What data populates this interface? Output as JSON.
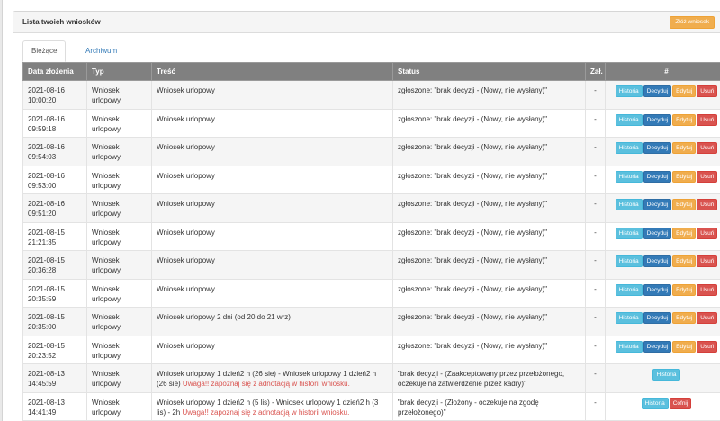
{
  "panel": {
    "title": "Lista twoich wniosków",
    "add_button": "Złóż wniosek"
  },
  "tabs": [
    {
      "label": "Bieżące",
      "active": true
    },
    {
      "label": "Archiwum",
      "active": false
    }
  ],
  "columns": [
    "Data złożenia",
    "Typ",
    "Treść",
    "Status",
    "Zał.",
    "#"
  ],
  "actions": {
    "history": "Historia",
    "decide": "Decyduj",
    "edit": "Edytuj",
    "delete": "Usuń",
    "withdraw": "Cofnij"
  },
  "rows": [
    {
      "date": "2021-08-16",
      "time": "10:00:20",
      "type": "Wniosek urlopowy",
      "content": "Wniosek urlopowy",
      "warning": "",
      "status": "zgłoszone: \"brak decyzji - (Nowy, nie wysłany)\"",
      "att": "-",
      "actions": "full"
    },
    {
      "date": "2021-08-16",
      "time": "09:59:18",
      "type": "Wniosek urlopowy",
      "content": "Wniosek urlopowy",
      "warning": "",
      "status": "zgłoszone: \"brak decyzji - (Nowy, nie wysłany)\"",
      "att": "-",
      "actions": "full"
    },
    {
      "date": "2021-08-16",
      "time": "09:54:03",
      "type": "Wniosek urlopowy",
      "content": "Wniosek urlopowy",
      "warning": "",
      "status": "zgłoszone: \"brak decyzji - (Nowy, nie wysłany)\"",
      "att": "-",
      "actions": "full"
    },
    {
      "date": "2021-08-16",
      "time": "09:53:00",
      "type": "Wniosek urlopowy",
      "content": "Wniosek urlopowy",
      "warning": "",
      "status": "zgłoszone: \"brak decyzji - (Nowy, nie wysłany)\"",
      "att": "-",
      "actions": "full"
    },
    {
      "date": "2021-08-16",
      "time": "09:51:20",
      "type": "Wniosek urlopowy",
      "content": "Wniosek urlopowy",
      "warning": "",
      "status": "zgłoszone: \"brak decyzji - (Nowy, nie wysłany)\"",
      "att": "-",
      "actions": "full"
    },
    {
      "date": "2021-08-15",
      "time": "21:21:35",
      "type": "Wniosek urlopowy",
      "content": "Wniosek urlopowy",
      "warning": "",
      "status": "zgłoszone: \"brak decyzji - (Nowy, nie wysłany)\"",
      "att": "-",
      "actions": "full"
    },
    {
      "date": "2021-08-15",
      "time": "20:36:28",
      "type": "Wniosek urlopowy",
      "content": "Wniosek urlopowy",
      "warning": "",
      "status": "zgłoszone: \"brak decyzji - (Nowy, nie wysłany)\"",
      "att": "-",
      "actions": "full"
    },
    {
      "date": "2021-08-15",
      "time": "20:35:59",
      "type": "Wniosek urlopowy",
      "content": "Wniosek urlopowy",
      "warning": "",
      "status": "zgłoszone: \"brak decyzji - (Nowy, nie wysłany)\"",
      "att": "-",
      "actions": "full"
    },
    {
      "date": "2021-08-15",
      "time": "20:35:00",
      "type": "Wniosek urlopowy",
      "content": "Wniosek urlopowy 2 dni (od 20 do 21 wrz)",
      "warning": "",
      "status": "zgłoszone: \"brak decyzji - (Nowy, nie wysłany)\"",
      "att": "-",
      "actions": "full"
    },
    {
      "date": "2021-08-15",
      "time": "20:23:52",
      "type": "Wniosek urlopowy",
      "content": "Wniosek urlopowy",
      "warning": "",
      "status": "zgłoszone: \"brak decyzji - (Nowy, nie wysłany)\"",
      "att": "-",
      "actions": "full"
    },
    {
      "date": "2021-08-13",
      "time": "14:45:59",
      "type": "Wniosek urlopowy",
      "content": "Wniosek urlopowy 1 dzień2 h (26 sie) - Wniosek urlopowy 1 dzień2 h (26 sie)",
      "warning": "Uwaga!! zapoznaj się z adnotacją w historii wniosku.",
      "status": "\"brak decyzji - (Zaakceptowany przez przełożonego, oczekuje na zatwierdzenie przez kadry)\"",
      "att": "-",
      "actions": "history"
    },
    {
      "date": "2021-08-13",
      "time": "14:41:49",
      "type": "Wniosek urlopowy",
      "content": "Wniosek urlopowy 1 dzień2 h (5 lis) - Wniosek urlopowy 1 dzień2 h (3 lis) - 2h",
      "warning": "Uwaga!! zapoznaj się z adnotacją w historii wniosku.",
      "status": "\"brak decyzji - (Złożony - oczekuje na zgodę przełożonego)\"",
      "att": "-",
      "actions": "history-withdraw"
    }
  ]
}
